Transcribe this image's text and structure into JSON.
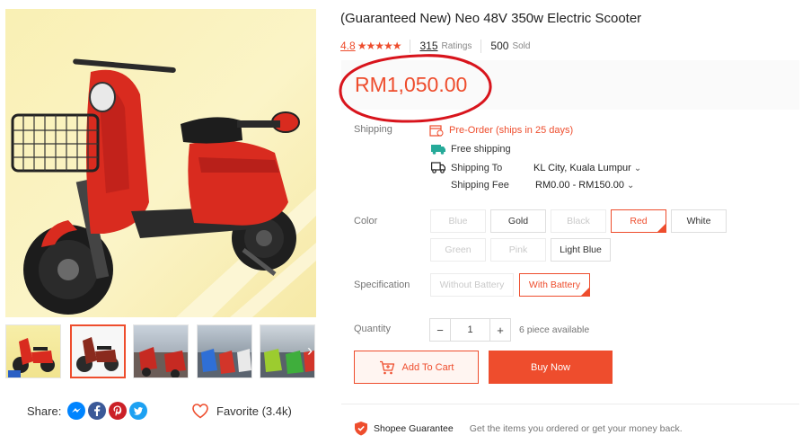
{
  "product": {
    "title": "(Guaranteed New) Neo 48V 350w Electric Scooter",
    "rating": "4.8",
    "stars": "★★★★★",
    "ratings_count": "315",
    "ratings_label": "Ratings",
    "sold_count": "500",
    "sold_label": "Sold",
    "price": "RM1,050.00"
  },
  "shipping": {
    "label": "Shipping",
    "preorder": "Pre-Order (ships in 25 days)",
    "free_shipping": "Free shipping",
    "shipping_to_label": "Shipping To",
    "shipping_to_value": "KL City, Kuala Lumpur",
    "shipping_fee_label": "Shipping Fee",
    "shipping_fee_value": "RM0.00 - RM150.00"
  },
  "color": {
    "label": "Color",
    "options": [
      {
        "label": "Blue",
        "state": "disabled"
      },
      {
        "label": "Gold",
        "state": "normal"
      },
      {
        "label": "Black",
        "state": "disabled"
      },
      {
        "label": "Red",
        "state": "selected"
      },
      {
        "label": "White",
        "state": "normal"
      },
      {
        "label": "Green",
        "state": "disabled"
      },
      {
        "label": "Pink",
        "state": "disabled"
      },
      {
        "label": "Light Blue",
        "state": "normal"
      }
    ]
  },
  "specification": {
    "label": "Specification",
    "options": [
      {
        "label": "Without Battery",
        "state": "disabled"
      },
      {
        "label": "With Battery",
        "state": "selected"
      }
    ]
  },
  "quantity": {
    "label": "Quantity",
    "minus": "−",
    "value": "1",
    "plus": "+",
    "available": "6 piece available"
  },
  "actions": {
    "add_to_cart": "Add To Cart",
    "buy_now": "Buy Now"
  },
  "share": {
    "label": "Share:",
    "icons": [
      "messenger-icon",
      "facebook-icon",
      "pinterest-icon",
      "twitter-icon"
    ]
  },
  "favorite": {
    "label": "Favorite (3.4k)"
  },
  "guarantee": {
    "title": "Shopee Guarantee",
    "text": "Get the items you ordered or get your money back."
  },
  "colors": {
    "accent": "#ee4d2d",
    "scooter_red": "#d92b1f",
    "image_background": "#f9f0b4",
    "annotation_circle": "#d8141c"
  }
}
